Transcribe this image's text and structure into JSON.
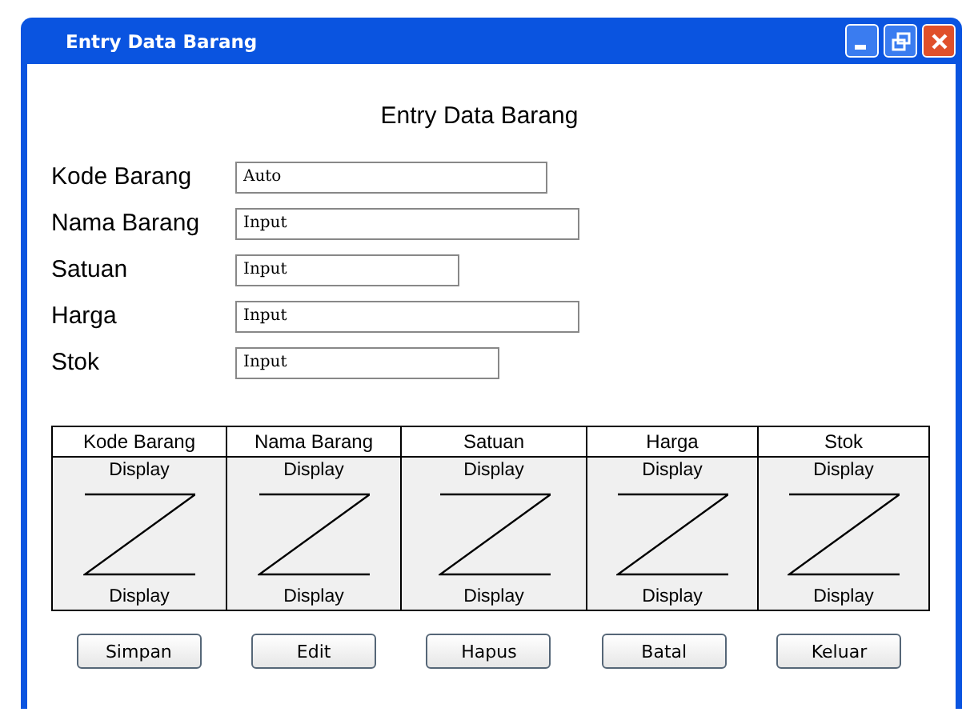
{
  "window": {
    "title": "Entry Data Barang"
  },
  "heading": "Entry Data Barang",
  "fields": [
    {
      "label": "Kode Barang",
      "value": "Auto"
    },
    {
      "label": "Nama Barang",
      "value": "Input"
    },
    {
      "label": "Satuan",
      "value": "Input"
    },
    {
      "label": "Harga",
      "value": "Input"
    },
    {
      "label": "Stok",
      "value": "Input"
    }
  ],
  "table": {
    "columns": [
      "Kode Barang",
      "Nama Barang",
      "Satuan",
      "Harga",
      "Stok"
    ],
    "cells": [
      {
        "top": "Display",
        "bottom": "Display"
      },
      {
        "top": "Display",
        "bottom": "Display"
      },
      {
        "top": "Display",
        "bottom": "Display"
      },
      {
        "top": "Display",
        "bottom": "Display"
      },
      {
        "top": "Display",
        "bottom": "Display"
      }
    ]
  },
  "buttons": [
    "Simpan",
    "Edit",
    "Hapus",
    "Batal",
    "Keluar"
  ]
}
